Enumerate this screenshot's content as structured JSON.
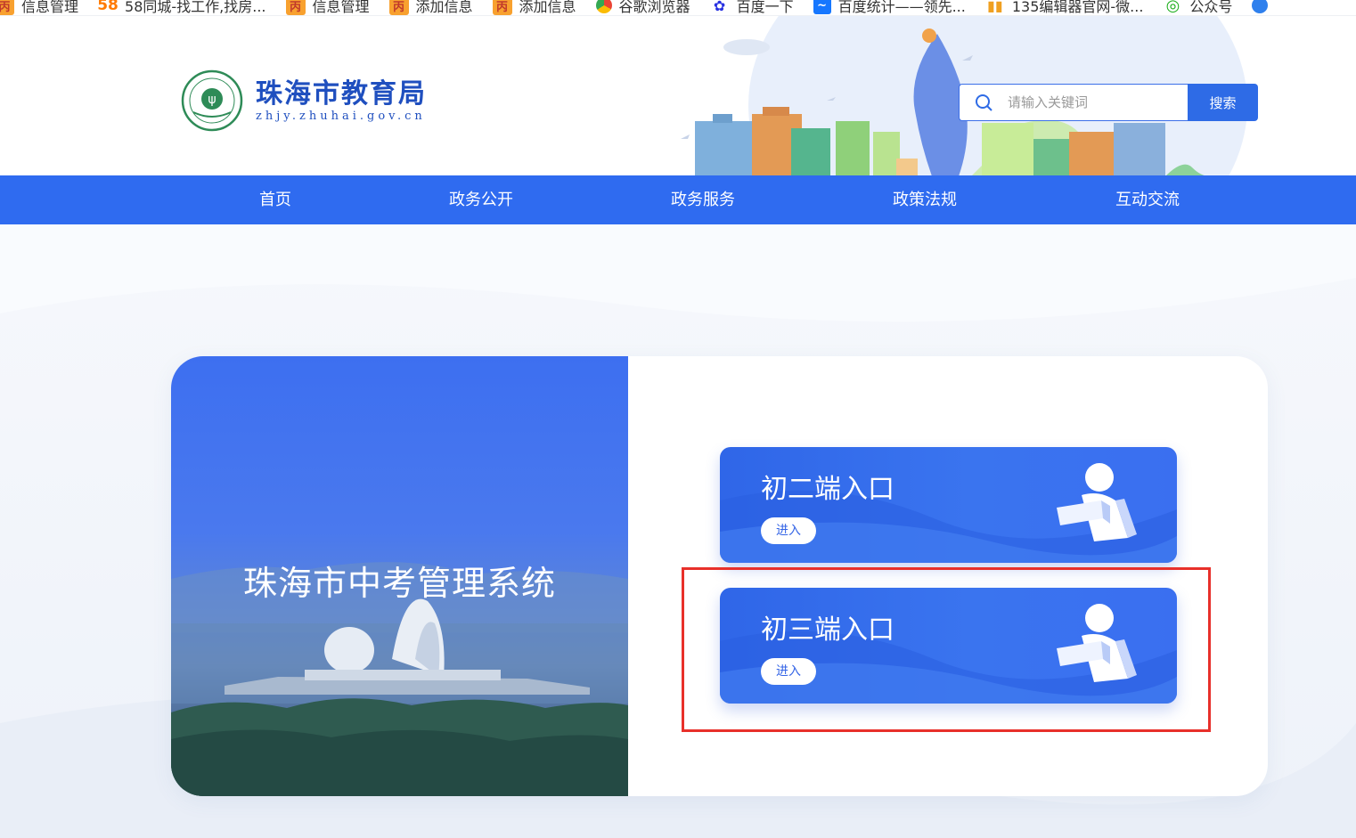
{
  "bookmarks": [
    {
      "label": "信息管理",
      "icon": "admin-icon"
    },
    {
      "label": "58同城-找工作,找房...",
      "icon": "58-icon"
    },
    {
      "label": "信息管理",
      "icon": "admin-icon"
    },
    {
      "label": "添加信息",
      "icon": "admin-icon"
    },
    {
      "label": "添加信息",
      "icon": "admin-icon"
    },
    {
      "label": "谷歌浏览器",
      "icon": "chrome-icon"
    },
    {
      "label": "百度一下",
      "icon": "baidu-icon"
    },
    {
      "label": "百度统计——领先...",
      "icon": "baidu-tongji-icon"
    },
    {
      "label": "135编辑器官网-微...",
      "icon": "135-icon"
    },
    {
      "label": "公众号",
      "icon": "wechat-icon"
    }
  ],
  "header": {
    "site_title": "珠海市教育局",
    "site_domain": "zhjy.zhuhai.gov.cn",
    "search_placeholder": "请输入关键词",
    "search_button": "搜索"
  },
  "nav": [
    {
      "label": "首页"
    },
    {
      "label": "政务公开"
    },
    {
      "label": "政务服务"
    },
    {
      "label": "政策法规"
    },
    {
      "label": "互动交流"
    }
  ],
  "main": {
    "system_title": "珠海市中考管理系统",
    "entries": [
      {
        "title": "初二端入口",
        "button": "进入"
      },
      {
        "title": "初三端入口",
        "button": "进入"
      }
    ]
  },
  "colors": {
    "brand_blue": "#2f6bf0",
    "highlight_red": "#e8302a"
  }
}
